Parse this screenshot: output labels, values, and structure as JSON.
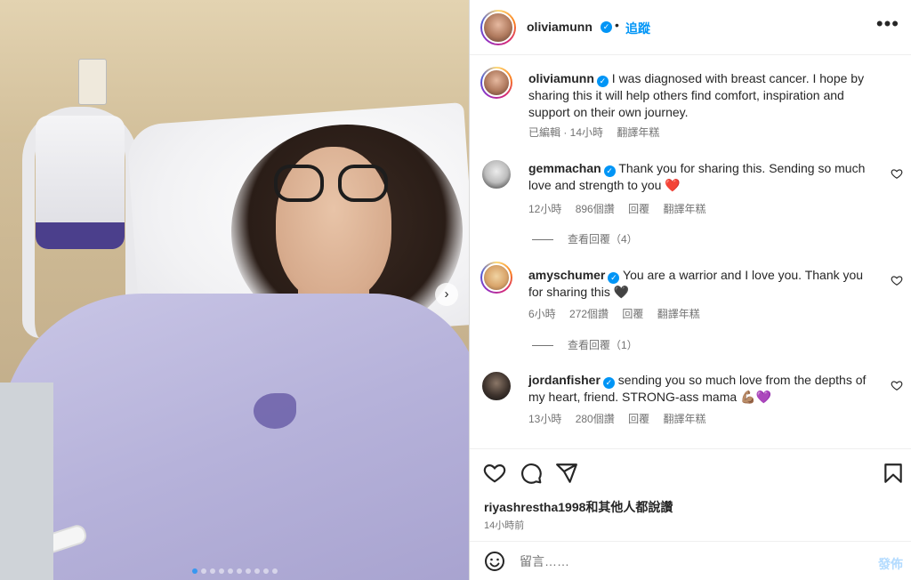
{
  "post": {
    "username": "oliviamunn",
    "follow_label": "追蹤",
    "separator": "•",
    "more_label": "•••",
    "caption_user": "oliviamunn",
    "caption_text": "I was diagnosed with breast cancer. I hope by sharing this it will help others find comfort, inspiration and support on their own journey.",
    "caption_meta": {
      "edited": "已編輯 · 14小時",
      "translate": "翻譯年糕"
    },
    "carousel": {
      "total": 10,
      "active_index": 0
    }
  },
  "comments": [
    {
      "user": "gemmachan",
      "text": "Thank you for sharing this. Sending so much love and strength to you ❤️",
      "time": "12小時",
      "likes": "896個讚",
      "reply": "回覆",
      "translate": "翻譯年糕",
      "view_replies": "查看回覆（4）"
    },
    {
      "user": "amyschumer",
      "text": "You are a warrior and I love you. Thank you for sharing this 🖤",
      "time": "6小時",
      "likes": "272個讚",
      "reply": "回覆",
      "translate": "翻譯年糕",
      "view_replies": "查看回覆（1）"
    },
    {
      "user": "jordanfisher",
      "text": "sending you so much love from the depths of my heart, friend. STRONG-ass mama 💪🏽💜",
      "time": "13小時",
      "likes": "280個讚",
      "reply": "回覆",
      "translate": "翻譯年糕"
    }
  ],
  "footer": {
    "liked_by": "riyashrestha1998和其他人都說讚",
    "time_ago": "14小時前",
    "comment_placeholder": "留言……",
    "post_label": "發佈"
  },
  "icons": {
    "next": "chevron-right-icon",
    "like": "heart-icon",
    "comment": "speech-bubble-icon",
    "share": "paper-plane-icon",
    "save": "bookmark-icon",
    "emoji": "smiley-icon",
    "comment_like": "small-heart-icon"
  },
  "colors": {
    "link_blue": "#0095f6",
    "muted_text": "#737373",
    "post_disabled": "#b3dbff",
    "verified": "#0095f6"
  }
}
